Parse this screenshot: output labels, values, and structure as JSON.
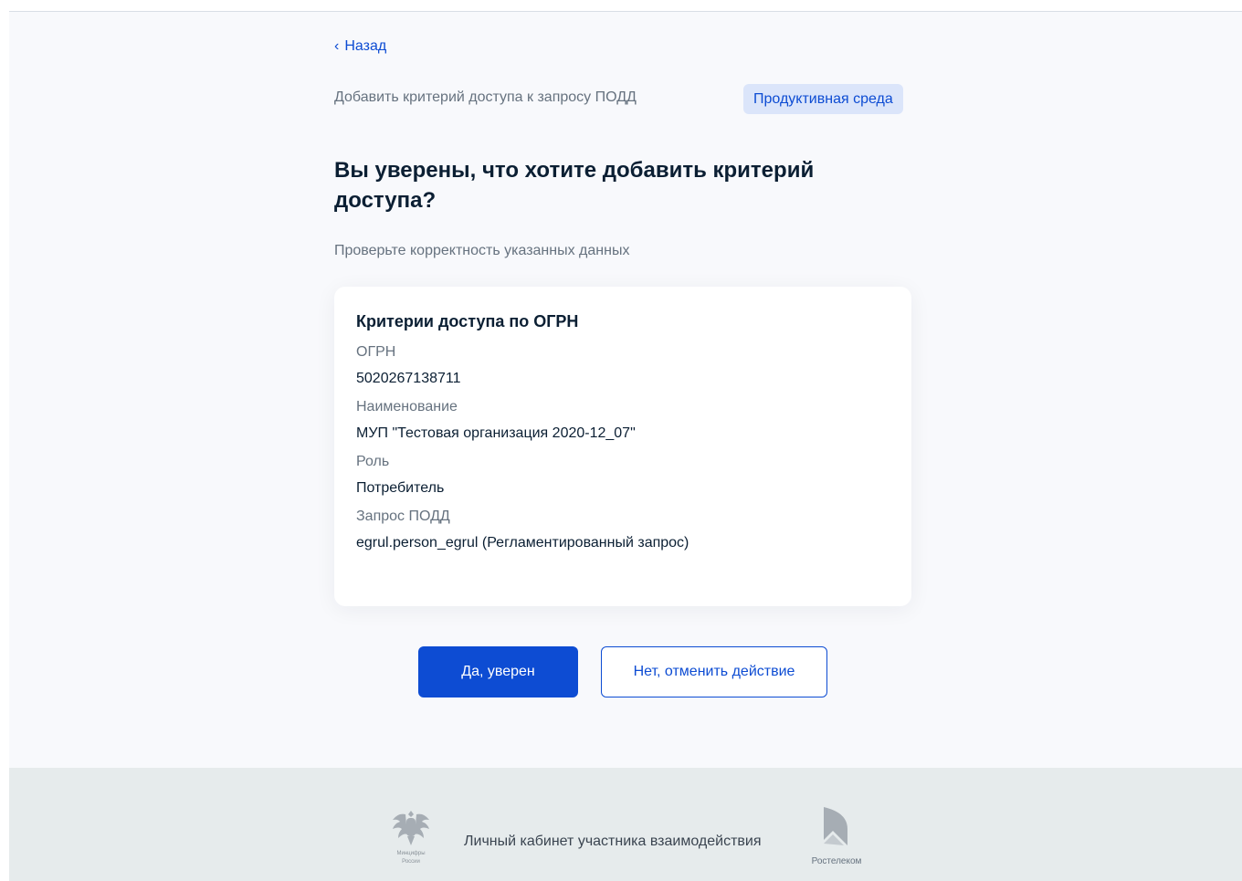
{
  "nav": {
    "back_label": "Назад"
  },
  "header": {
    "subtitle": "Добавить критерий доступа к запросу ПОДД",
    "environment_badge": "Продуктивная среда"
  },
  "page": {
    "title": "Вы уверены, что хотите добавить критерий доступа?",
    "hint": "Проверьте корректность указанных данных"
  },
  "card": {
    "title": "Критерии доступа по ОГРН",
    "fields": [
      {
        "label": "ОГРН",
        "value": "5020267138711"
      },
      {
        "label": "Наименование",
        "value": "МУП \"Тестовая организация 2020-12_07\""
      },
      {
        "label": "Роль",
        "value": "Потребитель"
      },
      {
        "label": "Запрос ПОДД",
        "value": "egrul.person_egrul (Регламентированный запрос)"
      }
    ]
  },
  "actions": {
    "confirm_label": "Да, уверен",
    "cancel_label": "Нет, отменить действие"
  },
  "footer": {
    "emblem_caption_1": "Минцифры",
    "emblem_caption_2": "России",
    "text": "Личный кабинет участника взаимодействия",
    "partner_caption": "Ростелеком"
  },
  "colors": {
    "accent": "#0d4cd3",
    "badge_bg": "#dbe5fa",
    "page_bg": "#f8f9fc",
    "footer_bg": "#e6ebec"
  }
}
